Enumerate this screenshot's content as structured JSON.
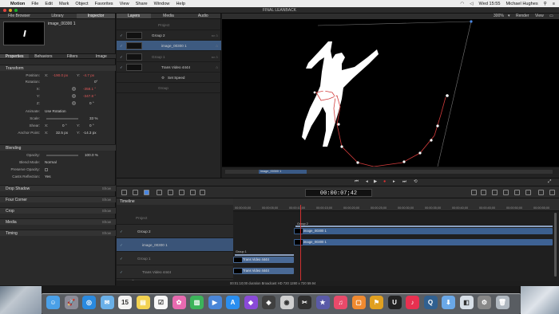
{
  "menubar": {
    "app": "Motion",
    "items": [
      "File",
      "Edit",
      "Mark",
      "Object",
      "Favorites",
      "View",
      "Share",
      "Window",
      "Help"
    ],
    "clock": "Wed 15:55",
    "user": "Michael Hughes"
  },
  "window": {
    "title": "FINAL LEANBACK"
  },
  "left_tabs": [
    "File Browser",
    "Library",
    "Inspector"
  ],
  "preview": {
    "name": "image_00300 1"
  },
  "inspector_tabs": [
    "Properties",
    "Behaviors",
    "Filters",
    "Image"
  ],
  "transform": {
    "title": "Transform",
    "position": {
      "label": "Position:",
      "x": "-190.0 px",
      "y": "-4.7 px"
    },
    "rotation": {
      "label": "Rotation:",
      "value": "0°"
    },
    "rx": {
      "label": "X:",
      "value": "-358.1 °"
    },
    "ry": {
      "label": "Y:",
      "value": "-347.8 °"
    },
    "rz": {
      "label": "Z:",
      "value": "0 °"
    },
    "animate": {
      "label": "Animate:",
      "value": "Use Rotation"
    },
    "scale": {
      "label": "Scale:",
      "value": "33 %"
    },
    "shear": {
      "label": "Shear:",
      "x": "0 °",
      "y": "0 °"
    },
    "anchor": {
      "label": "Anchor Point:",
      "x": "32.5 px",
      "y": "-14.3 px"
    }
  },
  "blending": {
    "title": "Blending",
    "opacity": {
      "label": "Opacity:",
      "value": "100.0 %"
    },
    "blend": {
      "label": "Blend Mode:",
      "value": "Normal"
    },
    "preserve": {
      "label": "Preserve Opacity:"
    },
    "casts": {
      "label": "Casts Reflection:",
      "value": "Yes"
    }
  },
  "sections": [
    "Drop Shadow",
    "Four Corner",
    "Crop",
    "Media",
    "Timing"
  ],
  "show_label": "Show",
  "layers_tabs": [
    "Layers",
    "Media",
    "Audio"
  ],
  "layers": {
    "project": "Project",
    "group2": "Group 2",
    "image": "image_00300 1",
    "group1": "Group 1",
    "trans": "Trans Video 4444",
    "setspeed": "Set Speed",
    "group": "Group"
  },
  "canvas": {
    "zoom": "300%",
    "render": "Render",
    "view": "View"
  },
  "mini_clip": "image_00300 1",
  "timecode": "00:00:07;42",
  "timeline": {
    "title": "Timeline",
    "rows": {
      "project": "Project",
      "group2": "Group 2",
      "image": "image_00300 1",
      "group1": "Group 1",
      "trans": "Trans Video 4444",
      "small": "Small"
    },
    "ticks": [
      "00:00:00;00",
      "00:00:05;00",
      "00:00:10;00",
      "00:00:15;00",
      "00:00:20;00",
      "00:00:25;00",
      "00:00:30;00",
      "00:00:35;00",
      "00:00:40;00",
      "00:00:45;00",
      "00:00:50;00",
      "00:00:55;00"
    ],
    "bars": {
      "group2": "Group 2",
      "image_a": "image_00300 1",
      "image_b": "image_00300 1",
      "group1": "Group 1",
      "trans_a": "Trans Video 4444",
      "trans_b": "Trans Video 4444"
    }
  },
  "status": "00:01:10;00 duration Broadcast HD 720 1280 x 720 59.94",
  "dock": {
    "icons": [
      "finder-icon",
      "launchpad-icon",
      "safari-icon",
      "mail-icon",
      "calendar-icon",
      "notes-icon",
      "reminders-icon",
      "photos-icon",
      "numbers-icon",
      "keynote-icon",
      "app-store-icon",
      "motion-icon",
      "compressor-icon",
      "dvd-icon",
      "final-cut-icon",
      "imovie-icon",
      "itunes-icon",
      "ibooks-icon",
      "app-icon",
      "unity-icon",
      "music-icon",
      "quicktime-icon",
      "downloads-icon",
      "preview-icon",
      "system-icon",
      "trash-icon"
    ]
  }
}
